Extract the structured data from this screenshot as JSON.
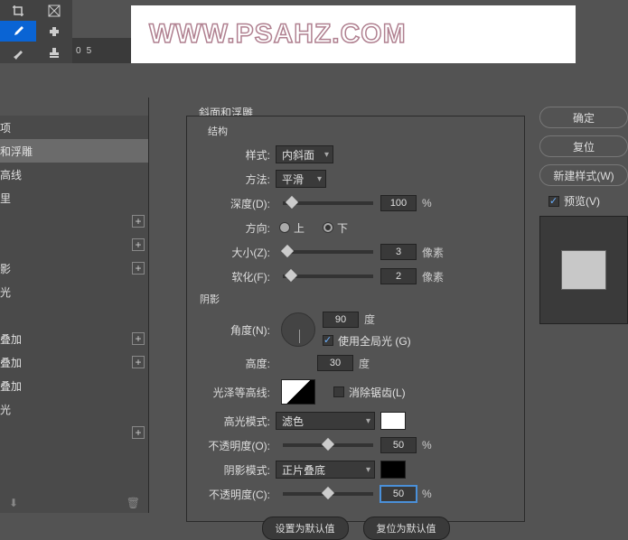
{
  "watermark": "WWW.PSAHZ.COM",
  "ruler": {
    "n1": "0",
    "n2": "5"
  },
  "dialog": {
    "title": "斜面和浮雕",
    "group_struct": "结构",
    "group_shadow": "阴影",
    "styles": {
      "item1": "项",
      "item2": "和浮雕",
      "item3": "高线",
      "item4": "里",
      "item5": "",
      "item6": "",
      "item7": "影",
      "item8": "光",
      "item9": "",
      "item10": "叠加",
      "item11": "叠加",
      "item12": "叠加",
      "item13": "光",
      "item14": ""
    },
    "labels": {
      "style": "样式:",
      "tech": "方法:",
      "depth": "深度(D):",
      "direction": "方向:",
      "dir_up": "上",
      "dir_down": "下",
      "size": "大小(Z):",
      "soften": "软化(F):",
      "angle": "角度(N):",
      "global": "使用全局光 (G)",
      "altitude": "高度:",
      "gloss": "光泽等高线:",
      "antialias": "消除锯齿(L)",
      "hilite_mode": "高光模式:",
      "opacity_o": "不透明度(O):",
      "shadow_mode": "阴影模式:",
      "opacity_c": "不透明度(C):"
    },
    "values": {
      "style": "内斜面",
      "tech": "平滑",
      "depth": "100",
      "size": "3",
      "soften": "2",
      "angle": "90",
      "altitude": "30",
      "hilite_mode": "滤色",
      "opacity_o": "50",
      "shadow_mode": "正片叠底",
      "opacity_c": "50"
    },
    "units": {
      "pct": "%",
      "px": "像素",
      "deg": "度"
    },
    "buttons": {
      "default": "设置为默认值",
      "reset": "复位为默认值"
    }
  },
  "right": {
    "ok": "确定",
    "cancel": "复位",
    "new": "新建样式(W)",
    "preview": "预览(V)"
  },
  "colors": {
    "hilite": "#ffffff",
    "shadow": "#000000"
  }
}
